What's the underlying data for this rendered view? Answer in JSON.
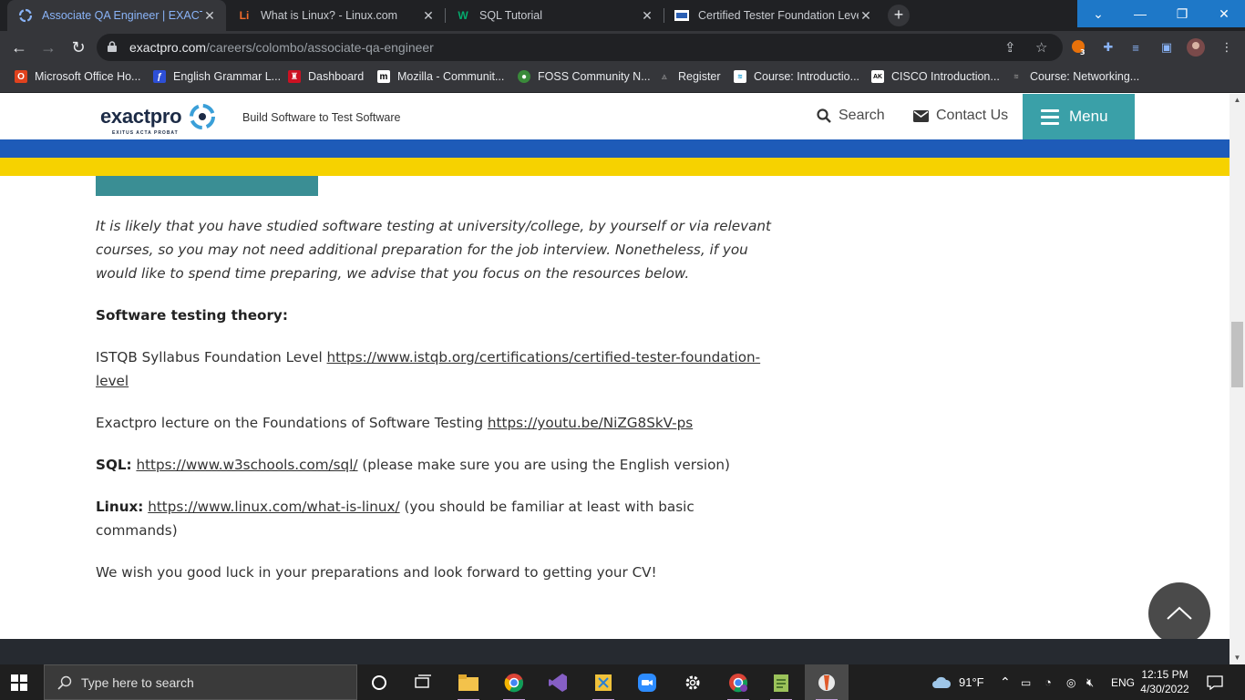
{
  "browser": {
    "tabs": [
      {
        "title": "Associate QA Engineer | EXACTPRO",
        "active": true
      },
      {
        "title": "What is Linux? - Linux.com",
        "active": false
      },
      {
        "title": "SQL Tutorial",
        "active": false
      },
      {
        "title": "Certified Tester Foundation Level",
        "active": false
      }
    ],
    "url_host": "exactpro.com",
    "url_path": "/careers/colombo/associate-qa-engineer",
    "extension_badge": "3",
    "bookmarks": [
      "Microsoft Office Ho...",
      "English Grammar L...",
      "Dashboard",
      "Mozilla - Communit...",
      "FOSS Community N...",
      "Register",
      "Course: Introductio...",
      "CISCO Introduction...",
      "Course: Networking..."
    ]
  },
  "site": {
    "logo": "exactpro",
    "logo_motto": "EXITUS ACTA PROBAT",
    "tagline": "Build Software to Test Software",
    "search_label": "Search",
    "contact_label": "Contact Us",
    "menu_label": "Menu",
    "flag_colors": {
      "top": "#1e5bb8",
      "bottom": "#f6d200"
    },
    "accent": "#3aa0a8"
  },
  "content": {
    "intro": "It is likely that you have studied software testing at university/college, by yourself or via relevant courses, so you may not need additional preparation for the job interview. Nonetheless, if you would like to spend time preparing, we advise that you focus on the resources below.",
    "theory_heading": "Software testing theory:",
    "istqb_text": "ISTQB Syllabus Foundation Level ",
    "istqb_link": "https://www.istqb.org/certifications/certified-tester-foundation-level",
    "lecture_text": "Exactpro lecture on the Foundations of Software Testing ",
    "lecture_link": "https://youtu.be/NiZG8SkV-ps ",
    "sql_label": "SQL:",
    "sql_link": "https://www.w3schools.com/sql/",
    "sql_note": " (please make sure you are using the English version)",
    "linux_label": "Linux:",
    "linux_link": "https://www.linux.com/what-is-linux/",
    "linux_note": " (you should be familiar at least with basic commands)",
    "closing": "We wish you good luck in your preparations and look forward to getting your CV!"
  },
  "taskbar": {
    "search_placeholder": "Type here to search",
    "weather": "91°F",
    "language": "ENG",
    "time": "12:15 PM",
    "date": "4/30/2022"
  }
}
